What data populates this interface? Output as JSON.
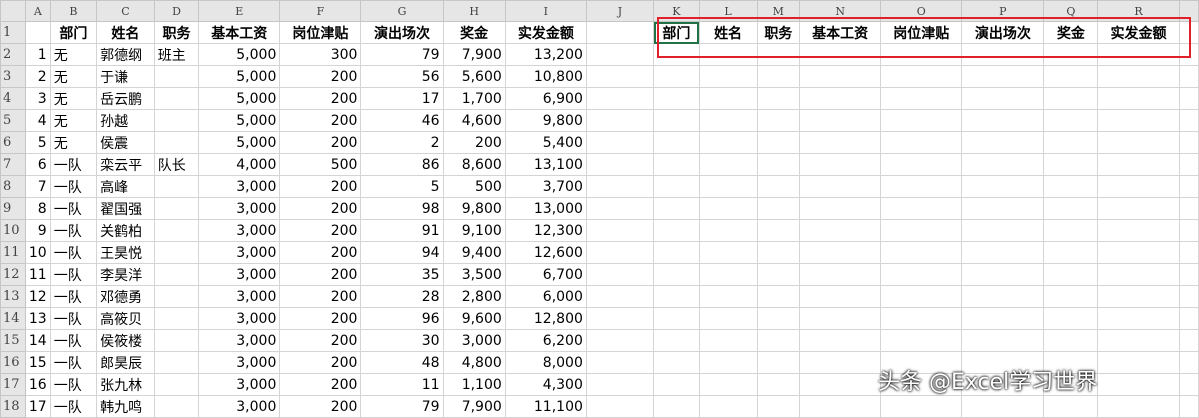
{
  "columns": [
    "",
    "A",
    "B",
    "C",
    "D",
    "E",
    "F",
    "G",
    "H",
    "I",
    "J",
    "K",
    "L",
    "M",
    "N",
    "O",
    "P",
    "Q",
    "R",
    ""
  ],
  "headers": [
    "部门",
    "姓名",
    "职务",
    "基本工资",
    "岗位津贴",
    "演出场次",
    "奖金",
    "实发金额"
  ],
  "rows": [
    [
      "1",
      "无",
      "郭德纲",
      "班主",
      "5,000",
      "300",
      "79",
      "7,900",
      "13,200"
    ],
    [
      "2",
      "无",
      "于谦",
      "",
      "5,000",
      "200",
      "56",
      "5,600",
      "10,800"
    ],
    [
      "3",
      "无",
      "岳云鹏",
      "",
      "5,000",
      "200",
      "17",
      "1,700",
      "6,900"
    ],
    [
      "4",
      "无",
      "孙越",
      "",
      "5,000",
      "200",
      "46",
      "4,600",
      "9,800"
    ],
    [
      "5",
      "无",
      "侯震",
      "",
      "5,000",
      "200",
      "2",
      "200",
      "5,400"
    ],
    [
      "6",
      "一队",
      "栾云平",
      "队长",
      "4,000",
      "500",
      "86",
      "8,600",
      "13,100"
    ],
    [
      "7",
      "一队",
      "高峰",
      "",
      "3,000",
      "200",
      "5",
      "500",
      "3,700"
    ],
    [
      "8",
      "一队",
      "翟国强",
      "",
      "3,000",
      "200",
      "98",
      "9,800",
      "13,000"
    ],
    [
      "9",
      "一队",
      "关鹤柏",
      "",
      "3,000",
      "200",
      "91",
      "9,100",
      "12,300"
    ],
    [
      "10",
      "一队",
      "王昊悦",
      "",
      "3,000",
      "200",
      "94",
      "9,400",
      "12,600"
    ],
    [
      "11",
      "一队",
      "李昊洋",
      "",
      "3,000",
      "200",
      "35",
      "3,500",
      "6,700"
    ],
    [
      "12",
      "一队",
      "邓德勇",
      "",
      "3,000",
      "200",
      "28",
      "2,800",
      "6,000"
    ],
    [
      "13",
      "一队",
      "高筱贝",
      "",
      "3,000",
      "200",
      "96",
      "9,600",
      "12,800"
    ],
    [
      "14",
      "一队",
      "侯筱楼",
      "",
      "3,000",
      "200",
      "30",
      "3,000",
      "6,200"
    ],
    [
      "15",
      "一队",
      "郎昊辰",
      "",
      "3,000",
      "200",
      "48",
      "4,800",
      "8,000"
    ],
    [
      "16",
      "一队",
      "张九林",
      "",
      "3,000",
      "200",
      "11",
      "1,100",
      "4,300"
    ],
    [
      "17",
      "一队",
      "韩九鸣",
      "",
      "3,000",
      "200",
      "79",
      "7,900",
      "11,100"
    ]
  ],
  "watermark": "头条 @Excel学习世界"
}
